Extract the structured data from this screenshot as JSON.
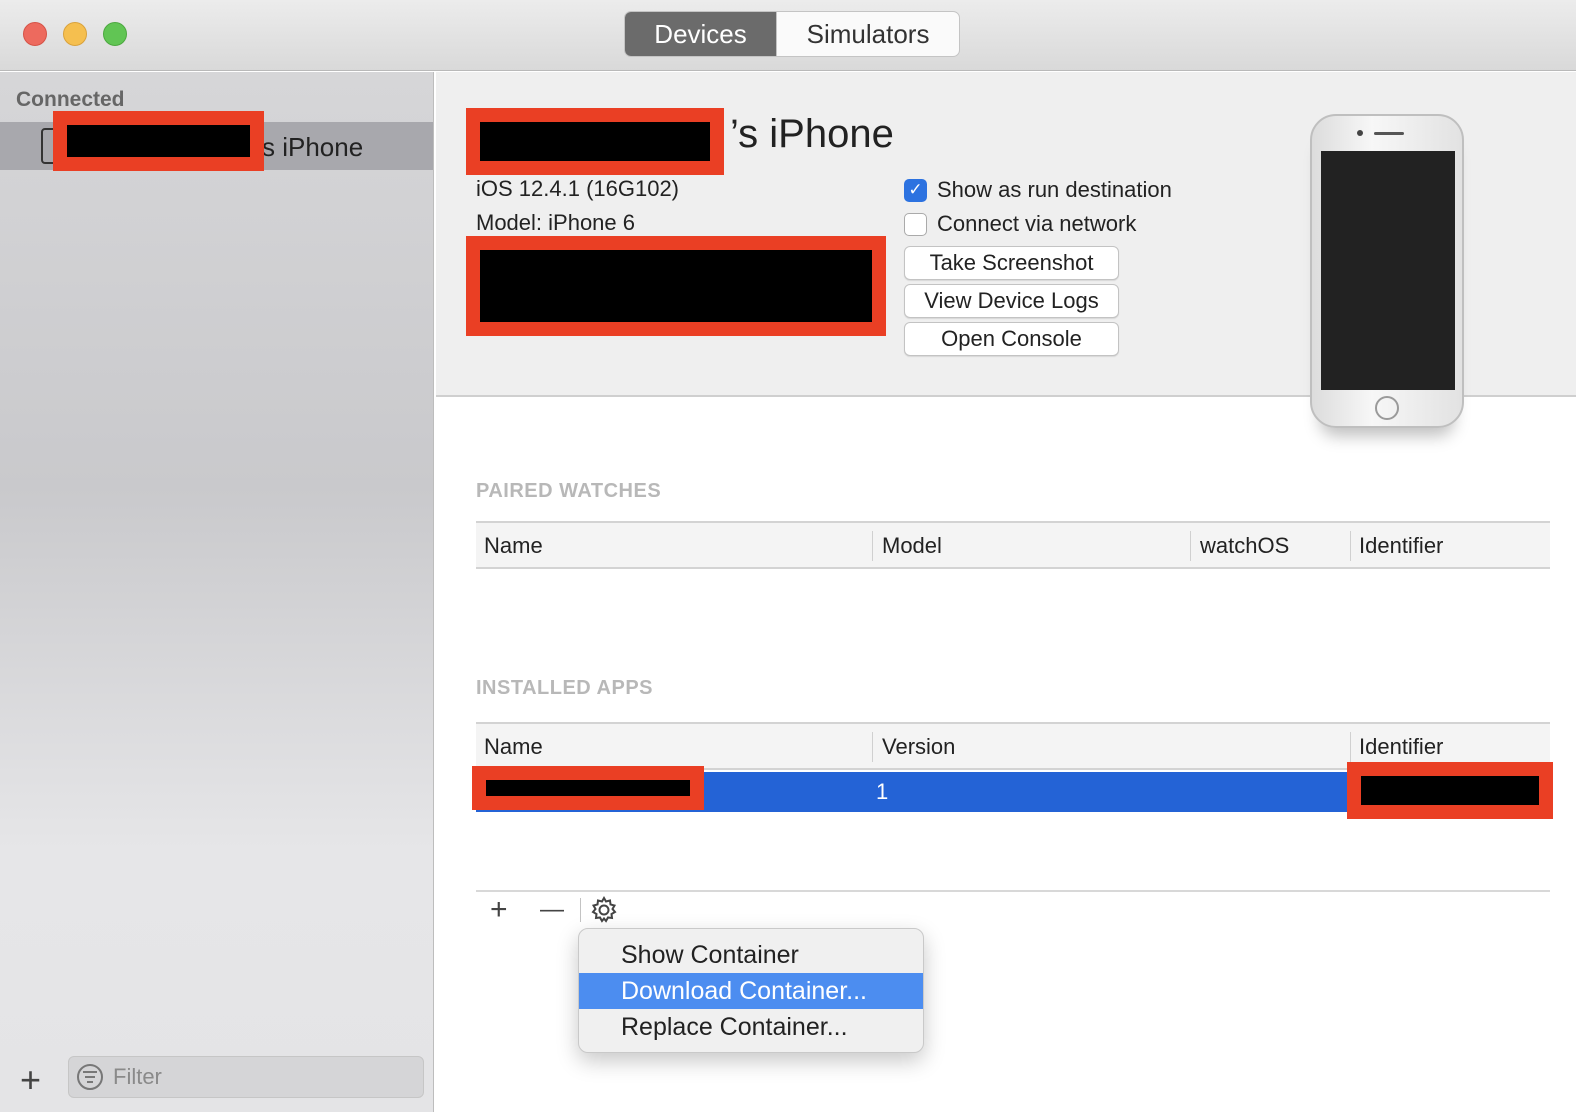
{
  "window": {
    "tabs": [
      {
        "label": "Devices",
        "active": true
      },
      {
        "label": "Simulators",
        "active": false
      }
    ]
  },
  "sidebar": {
    "section_header": "Connected",
    "device_item_label": "s iPhone",
    "add_label": "+",
    "filter_placeholder": "Filter"
  },
  "device": {
    "title_suffix": "’s iPhone",
    "os_version": "iOS 12.4.1 (16G102)",
    "model": "Model: iPhone 6",
    "show_as_run_destination": {
      "label": "Show as run destination",
      "checked": true
    },
    "connect_via_network": {
      "label": "Connect via network",
      "checked": false
    },
    "buttons": {
      "take_screenshot": "Take Screenshot",
      "view_device_logs": "View Device Logs",
      "open_console": "Open Console"
    }
  },
  "paired_watches": {
    "section_label": "PAIRED WATCHES",
    "columns": [
      "Name",
      "Model",
      "watchOS",
      "Identifier"
    ]
  },
  "installed_apps": {
    "section_label": "INSTALLED APPS",
    "columns": [
      "Name",
      "Version",
      "Identifier"
    ],
    "rows": [
      {
        "version": "1"
      }
    ],
    "toolbar": {
      "add": "+",
      "remove": "—"
    }
  },
  "context_menu": {
    "items": [
      "Show Container",
      "Download Container...",
      "Replace Container..."
    ],
    "highlighted_index": 1
  },
  "colors": {
    "selection_blue": "#2463d6",
    "menu_highlight": "#4c8df0",
    "redaction_red": "#ea3f24"
  }
}
